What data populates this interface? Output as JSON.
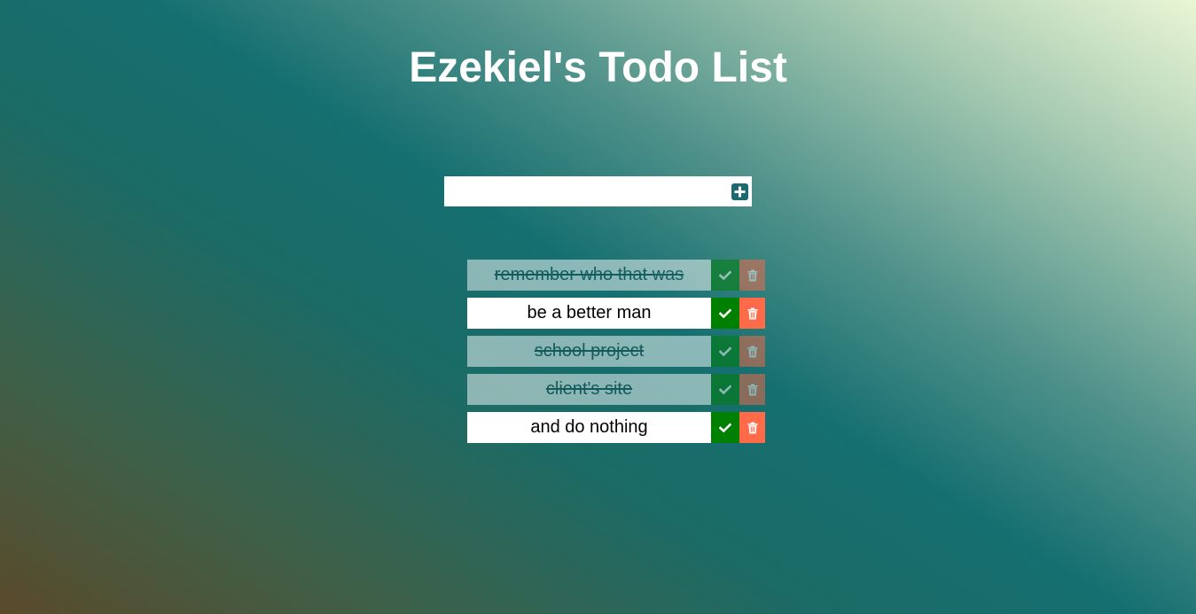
{
  "header": {
    "title": "Ezekiel's Todo List"
  },
  "add_form": {
    "input_value": "",
    "input_placeholder": "",
    "add_icon": "plus-square-icon"
  },
  "todos": [
    {
      "text": "remember who that was",
      "completed": true
    },
    {
      "text": "be a better man",
      "completed": false
    },
    {
      "text": "school project",
      "completed": true
    },
    {
      "text": "client's site",
      "completed": true
    },
    {
      "text": "and do nothing",
      "completed": false
    }
  ],
  "icons": {
    "complete": "check-icon",
    "delete": "trash-icon"
  },
  "colors": {
    "complete_button": "#008000",
    "delete_button": "#ff6a48",
    "add_button": "#1b6b6e",
    "title": "#ffffff"
  }
}
